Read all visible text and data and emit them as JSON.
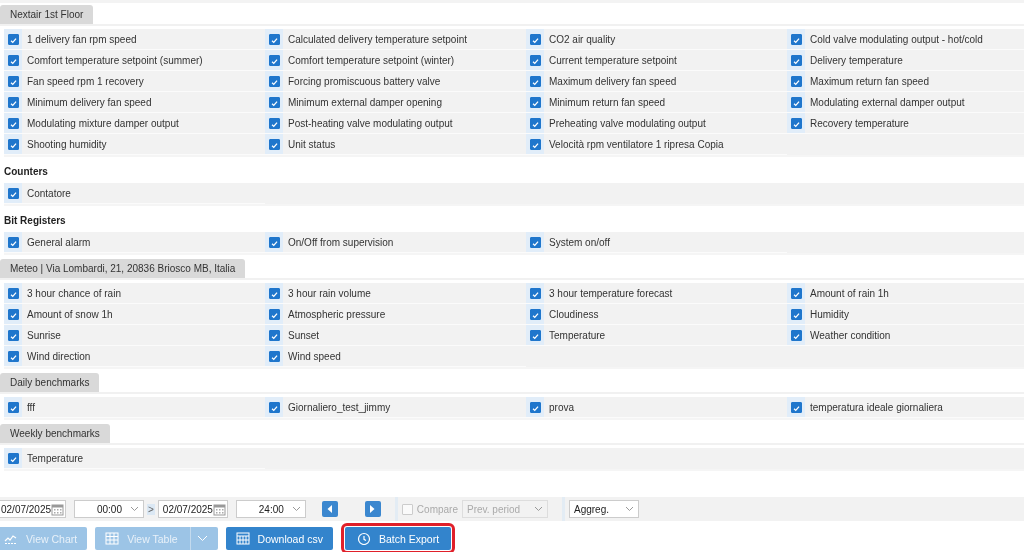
{
  "sections": [
    {
      "kind": "tab",
      "title": "Nextair 1st Floor",
      "items": [
        {
          "label": "1 delivery fan rpm speed",
          "checked": true
        },
        {
          "label": "Calculated delivery temperature setpoint",
          "checked": true
        },
        {
          "label": "CO2 air quality",
          "checked": true
        },
        {
          "label": "Cold valve modulating output - hot/cold",
          "checked": true
        },
        {
          "label": "Comfort temperature setpoint (summer)",
          "checked": true
        },
        {
          "label": "Comfort temperature setpoint (winter)",
          "checked": true
        },
        {
          "label": "Current temperature setpoint",
          "checked": true
        },
        {
          "label": "Delivery temperature",
          "checked": true
        },
        {
          "label": "Fan speed rpm 1 recovery",
          "checked": true
        },
        {
          "label": "Forcing promiscuous battery valve",
          "checked": true
        },
        {
          "label": "Maximum delivery fan speed",
          "checked": true
        },
        {
          "label": "Maximum return fan speed",
          "checked": true
        },
        {
          "label": "Minimum delivery fan speed",
          "checked": true
        },
        {
          "label": "Minimum external damper opening",
          "checked": true
        },
        {
          "label": "Minimum return fan speed",
          "checked": true
        },
        {
          "label": "Modulating external damper output",
          "checked": true
        },
        {
          "label": "Modulating mixture damper output",
          "checked": true
        },
        {
          "label": "Post-heating valve modulating output",
          "checked": true
        },
        {
          "label": "Preheating valve modulating output",
          "checked": true
        },
        {
          "label": "Recovery temperature",
          "checked": true
        },
        {
          "label": "Shooting humidity",
          "checked": true
        },
        {
          "label": "Unit status",
          "checked": true
        },
        {
          "label": "Velocità rpm ventilatore 1 ripresa Copia",
          "checked": true
        }
      ]
    },
    {
      "kind": "heading",
      "title": "Counters",
      "items": [
        {
          "label": "Contatore",
          "checked": true
        }
      ]
    },
    {
      "kind": "heading",
      "title": "Bit Registers",
      "items": [
        {
          "label": "General alarm",
          "checked": true
        },
        {
          "label": "On/Off from supervision",
          "checked": true
        },
        {
          "label": "System on/off",
          "checked": true
        }
      ]
    },
    {
      "kind": "tab",
      "title": "Meteo | Via Lombardi, 21, 20836 Briosco MB, Italia",
      "items": [
        {
          "label": "3 hour chance of rain",
          "checked": true
        },
        {
          "label": "3 hour rain volume",
          "checked": true
        },
        {
          "label": "3 hour temperature forecast",
          "checked": true
        },
        {
          "label": "Amount of rain 1h",
          "checked": true
        },
        {
          "label": "Amount of snow 1h",
          "checked": true
        },
        {
          "label": "Atmospheric pressure",
          "checked": true
        },
        {
          "label": "Cloudiness",
          "checked": true
        },
        {
          "label": "Humidity",
          "checked": true
        },
        {
          "label": "Sunrise",
          "checked": true
        },
        {
          "label": "Sunset",
          "checked": true
        },
        {
          "label": "Temperature",
          "checked": true
        },
        {
          "label": "Weather condition",
          "checked": true
        },
        {
          "label": "Wind direction",
          "checked": true
        },
        {
          "label": "Wind speed",
          "checked": true
        }
      ]
    },
    {
      "kind": "tab",
      "title": "Daily benchmarks",
      "items": [
        {
          "label": "fff",
          "checked": true
        },
        {
          "label": "Giornaliero_test_jimmy",
          "checked": true
        },
        {
          "label": "prova",
          "checked": true
        },
        {
          "label": "temperatura ideale giornaliera",
          "checked": true
        }
      ]
    },
    {
      "kind": "tab",
      "title": "Weekly benchmarks",
      "items": [
        {
          "label": "Temperature",
          "checked": true
        }
      ]
    }
  ],
  "toolbar": {
    "start_date": "02/07/2025",
    "start_time": "00:00",
    "range_separator": ">",
    "end_date": "02/07/2025",
    "end_time": "24:00",
    "compare": {
      "label": "Compare",
      "checked": false,
      "disabled": true
    },
    "compare_period": {
      "value": "Prev. period",
      "disabled": true
    },
    "aggregation": "Aggreg."
  },
  "buttons": [
    {
      "kind": "chart",
      "label": "View Chart",
      "disabled": true,
      "highlighted": false
    },
    {
      "kind": "table",
      "label": "View Table",
      "disabled": true,
      "highlighted": false
    },
    {
      "kind": "csv",
      "label": "Download csv",
      "disabled": false,
      "highlighted": false
    },
    {
      "kind": "batch",
      "label": "Batch Export",
      "disabled": false,
      "highlighted": true
    }
  ]
}
